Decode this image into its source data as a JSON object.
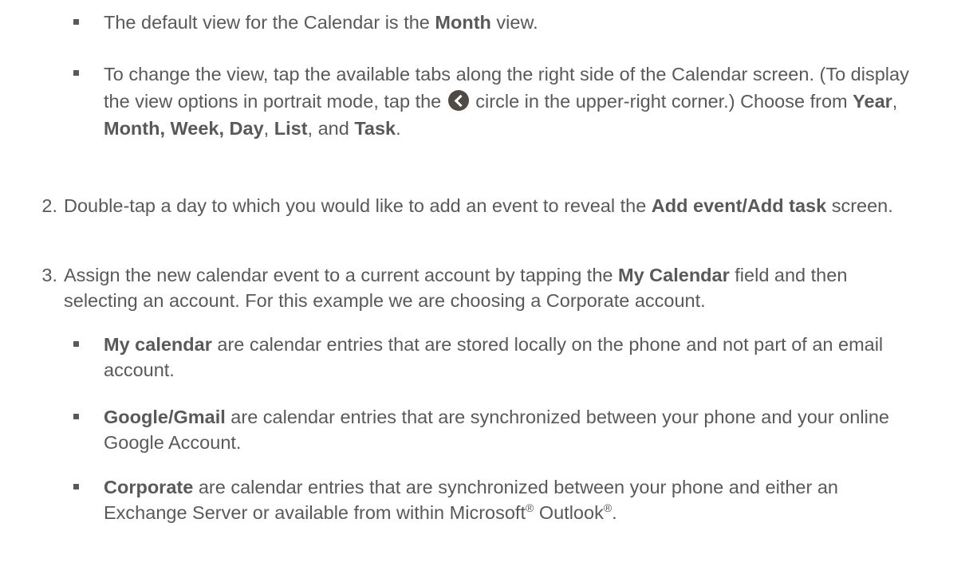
{
  "items": [
    {
      "type": "bullet",
      "parts": [
        {
          "t": "The default view for the Calendar is the "
        },
        {
          "t": "Month",
          "b": true
        },
        {
          "t": " view."
        }
      ]
    },
    {
      "type": "bullet",
      "parts": [
        {
          "t": "To change the view, tap the available tabs along the right side of the Calendar screen. (To display the view options in portrait mode, tap the "
        },
        {
          "icon": "chevron-circle-icon"
        },
        {
          "t": " circle in the upper-right corner.) Choose from "
        },
        {
          "t": "Year",
          "b": true
        },
        {
          "t": ", "
        },
        {
          "t": "Month, Week, Day",
          "b": true
        },
        {
          "t": ", "
        },
        {
          "t": "List",
          "b": true
        },
        {
          "t": ", and "
        },
        {
          "t": "Task",
          "b": true
        },
        {
          "t": "."
        }
      ]
    },
    {
      "type": "number",
      "marker": "2.",
      "parts": [
        {
          "t": "Double-tap a day to which you would like to add an event to reveal the "
        },
        {
          "t": "Add event/Add task",
          "b": true
        },
        {
          "t": " screen."
        }
      ]
    },
    {
      "type": "number",
      "marker": "3.",
      "parts": [
        {
          "t": "Assign the new calendar event to a current account by tapping the "
        },
        {
          "t": "My Calendar",
          "b": true
        },
        {
          "t": " field and then selecting an account. For this example we are choosing a Corporate account."
        }
      ]
    },
    {
      "type": "bullet",
      "parts": [
        {
          "t": "My calendar",
          "b": true
        },
        {
          "t": " are calendar entries that are stored locally on the phone and not part of an email account."
        }
      ]
    },
    {
      "type": "bullet",
      "parts": [
        {
          "t": "Google/Gmail",
          "b": true
        },
        {
          "t": " are calendar entries that are synchronized between your phone and your online Google Account."
        }
      ]
    },
    {
      "type": "bullet",
      "parts": [
        {
          "t": "Corporate",
          "b": true
        },
        {
          "t": " are calendar entries that are synchronized between your phone and either an Exchange Server or available from within Microsoft"
        },
        {
          "t": "®",
          "sup": true
        },
        {
          "t": " Outlook"
        },
        {
          "t": "®",
          "sup": true
        },
        {
          "t": "."
        }
      ]
    }
  ]
}
